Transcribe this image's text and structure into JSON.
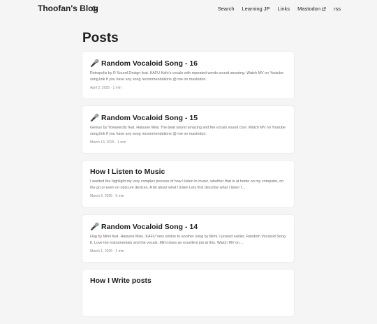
{
  "header": {
    "logo": "Thoofan's Blog",
    "theme_toggle_icon": "moon-icon",
    "menu": [
      {
        "label": "Search"
      },
      {
        "label": "Learning JP"
      },
      {
        "label": "Links"
      },
      {
        "label": "Mastodon",
        "icon": "external-link-icon"
      },
      {
        "label": "rss"
      }
    ]
  },
  "main": {
    "title": "Posts",
    "posts": [
      {
        "title": "🎤 Random Vocaloid Song - 16",
        "excerpt": "Retropolis by R Sound Design feat. KAFU Kafu's vocals with repeated words sound amazing. Watch MV on Youtube song.link If you have any song recommendations @ me on mastodon.",
        "meta": "April 2, 2025 · 1 min"
      },
      {
        "title": "🎤 Random Vocaloid Song - 15",
        "excerpt": "Genius by Yowanecity feat. Hatsune Miku The beat sound amazing and the vocals sound cool. Watch MV on Youtube song.link If you have any song recommendations @ me on mastodon.",
        "meta": "March 13, 2025 · 1 min"
      },
      {
        "title": "How I Listen to Music",
        "excerpt": "I wanted the highlight my very complex process of how I listen to music, whether that is at home on my computer, on the go or even on obscure devices. A bit about what I listen Lets first describe what I listen f…",
        "meta": "March 6, 2025 · 5 min"
      },
      {
        "title": "🎤 Random Vocaloid Song - 14",
        "excerpt": "Hug by Mimi feat. Hatsune Miku, KAFU Very similar to another song by Mimi. I posted earlier, Random Vocaloid Song 8. Love the instrumentals and the vocals, Mimi does an excellent job at this. Watch MV on…",
        "meta": "March 1, 2025 · 1 min"
      },
      {
        "title": "How I Write posts",
        "excerpt": "",
        "meta": ""
      }
    ]
  }
}
